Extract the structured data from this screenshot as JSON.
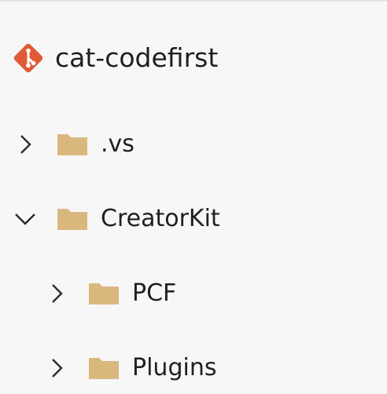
{
  "repo": {
    "name": "cat-codefirst",
    "icon": "git-repo-icon",
    "icon_color": "#e05a33"
  },
  "tree": {
    "folder_color": "#d9b87e",
    "items": [
      {
        "label": ".vs",
        "expanded": false,
        "depth": 0
      },
      {
        "label": "CreatorKit",
        "expanded": true,
        "depth": 0
      },
      {
        "label": "PCF",
        "expanded": false,
        "depth": 1
      },
      {
        "label": "Plugins",
        "expanded": false,
        "depth": 1
      }
    ]
  }
}
